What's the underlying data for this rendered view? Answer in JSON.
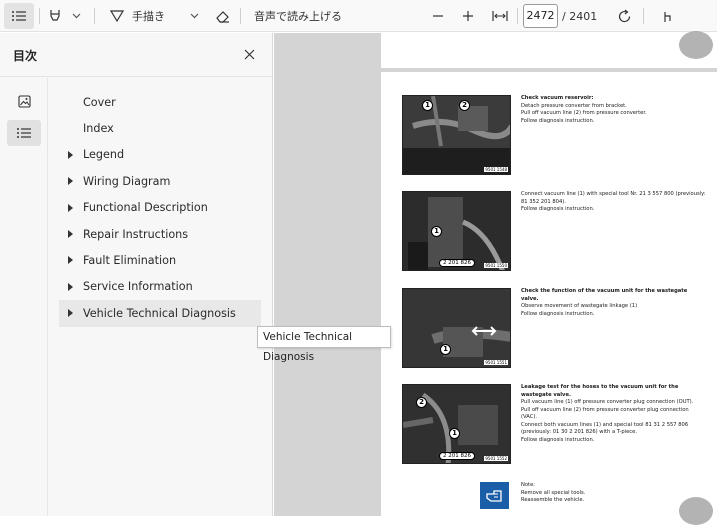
{
  "toolbar": {
    "read_aloud_label": "音声で読み上げる",
    "draw_label": "手描き",
    "page_current": "2472",
    "page_total": "/ 2401"
  },
  "sidebar": {
    "title": "目次",
    "items": [
      {
        "label": "Cover",
        "expandable": false
      },
      {
        "label": "Index",
        "expandable": false
      },
      {
        "label": "Legend",
        "expandable": true
      },
      {
        "label": "Wiring Diagram",
        "expandable": true
      },
      {
        "label": "Functional Description",
        "expandable": true
      },
      {
        "label": "Repair Instructions",
        "expandable": true
      },
      {
        "label": "Fault Elimination",
        "expandable": true
      },
      {
        "label": "Service Information",
        "expandable": true
      },
      {
        "label": "Vehicle Technical Diagnosis",
        "expandable": true,
        "selected": true
      }
    ],
    "tooltip": "Vehicle Technical Diagnosis"
  },
  "document": {
    "steps": [
      {
        "heading": "Check vacuum reservoir:",
        "lines": [
          "Detach pressure converter from bracket.",
          "Pull off vacuum line (2) from pressure converter.",
          "Follow diagnosis instruction."
        ],
        "callouts": [
          "1",
          "2"
        ],
        "image_code": "9501 1548"
      },
      {
        "heading": "",
        "lines": [
          "Connect vacuum line (1) with special tool Nr. 21 3 557 800 (previously: 81 352 201 804).",
          "Follow diagnosis instruction."
        ],
        "callouts": [
          "1"
        ],
        "tool_label": "2 201 826",
        "image_code": "9501 1550"
      },
      {
        "heading": "Check the function of the vacuum unit for the wastegate valve.",
        "lines": [
          "Observe movement of wastegate linkage (1)",
          "Follow diagnosis instruction."
        ],
        "callouts": [
          "1"
        ],
        "image_code": "9501 1551"
      },
      {
        "heading": "Leakage test for the hoses to the vacuum unit for the wastegate valve.",
        "lines": [
          "Pull vacuum line (1) off pressure converter plug connection (OUT).",
          "Pull off vacuum line (2) from pressure converter plug connection (VAC).",
          "Connect both vacuum lines (1) and special tool 81 31 2 557 806 (previously: 01 30 2 201 826) with a T-piece.",
          "Follow diagnosis instruction."
        ],
        "callouts": [
          "2",
          "1"
        ],
        "tool_label": "2 201 826",
        "image_code": "9501 1552"
      }
    ],
    "note": {
      "heading": "Note:",
      "lines": [
        "Remove all special tools.",
        "Reassemble the vehicle."
      ]
    }
  },
  "colors": {
    "note_icon": "#1a5ea8",
    "page_gutter": "#d4d4d4",
    "sidebar_bg": "#f7f7f7"
  },
  "icons": [
    "list-icon",
    "highlighter-icon",
    "chevron-down-icon",
    "draw-icon",
    "eraser-icon",
    "minus-icon",
    "plus-icon",
    "fit-width-icon",
    "rotate-icon",
    "touch-icon",
    "close-icon",
    "image-icon",
    "toc-list-icon"
  ]
}
